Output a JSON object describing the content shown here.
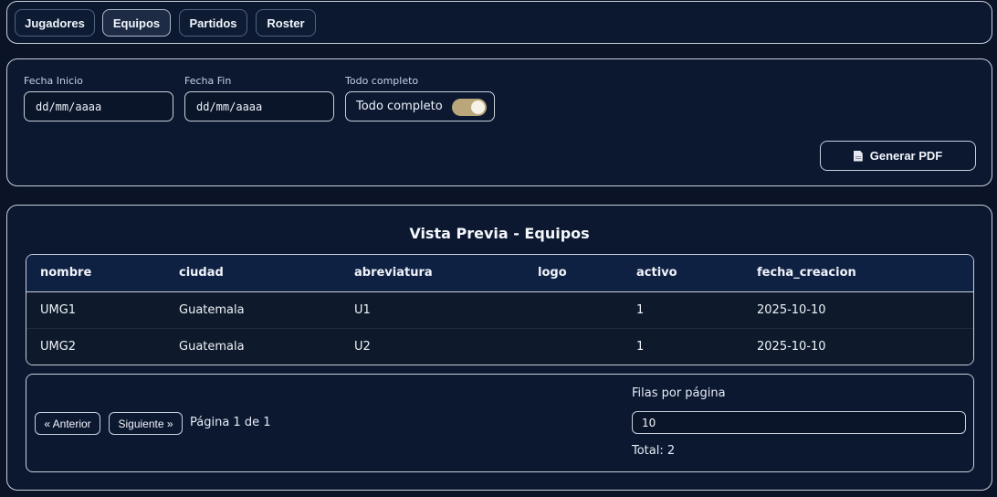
{
  "nav": {
    "tabs": [
      {
        "label": "Jugadores"
      },
      {
        "label": "Equipos"
      },
      {
        "label": "Partidos"
      },
      {
        "label": "Roster"
      }
    ],
    "active": "Equipos"
  },
  "filters": {
    "start_label": "Fecha Inicio",
    "start_placeholder": "dd/mm/aaaa",
    "end_label": "Fecha Fin",
    "end_placeholder": "dd/mm/aaaa",
    "all_label": "Todo completo",
    "all_toggle_text": "Todo completo",
    "all_toggle_on": true,
    "pdf_button": "Generar PDF"
  },
  "preview": {
    "title": "Vista Previa - Equipos",
    "columns": [
      "nombre",
      "ciudad",
      "abreviatura",
      "logo",
      "activo",
      "fecha_creacion"
    ],
    "rows": [
      [
        "UMG1",
        "Guatemala",
        "U1",
        "",
        "1",
        "2025-10-10"
      ],
      [
        "UMG2",
        "Guatemala",
        "U2",
        "",
        "1",
        "2025-10-10"
      ]
    ]
  },
  "pagination": {
    "prev": "« Anterior",
    "next": "Siguiente »",
    "page_info": "Página 1 de 1",
    "rows_label": "Filas por página",
    "rows_value": "10",
    "total": "Total: 2"
  },
  "colors": {
    "background": "#0a1426",
    "panel": "#0b1830",
    "toggle_on": "#b9a67a"
  }
}
